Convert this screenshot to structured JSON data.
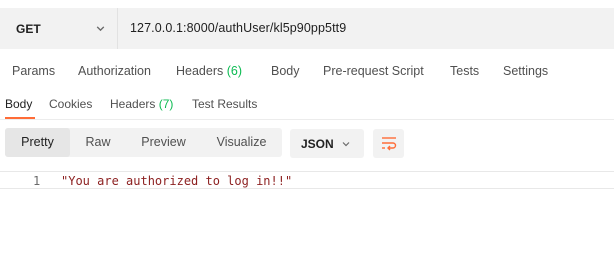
{
  "request": {
    "method": "GET",
    "url": "127.0.0.1:8000/authUser/kl5p90pp5tt9"
  },
  "request_tabs": [
    {
      "label": "Params",
      "count": ""
    },
    {
      "label": "Authorization",
      "count": ""
    },
    {
      "label": "Headers",
      "count": "(6)"
    },
    {
      "label": "Body",
      "count": ""
    },
    {
      "label": "Pre-request Script",
      "count": ""
    },
    {
      "label": "Tests",
      "count": ""
    },
    {
      "label": "Settings",
      "count": ""
    }
  ],
  "response_tabs": [
    {
      "label": "Body",
      "count": "",
      "active": true
    },
    {
      "label": "Cookies",
      "count": ""
    },
    {
      "label": "Headers",
      "count": "(7)"
    },
    {
      "label": "Test Results",
      "count": ""
    }
  ],
  "toolbar": {
    "views": [
      "Pretty",
      "Raw",
      "Preview",
      "Visualize"
    ],
    "active_view": "Pretty",
    "format": "JSON",
    "wrap_icon": "wrap-lines-icon"
  },
  "response_body": {
    "line_number": "1",
    "text": "\"You are authorized to log in!!\""
  },
  "colors": {
    "accent": "#ff6c37",
    "count_green": "#0cbb52",
    "string_red": "#8c1f1f"
  }
}
